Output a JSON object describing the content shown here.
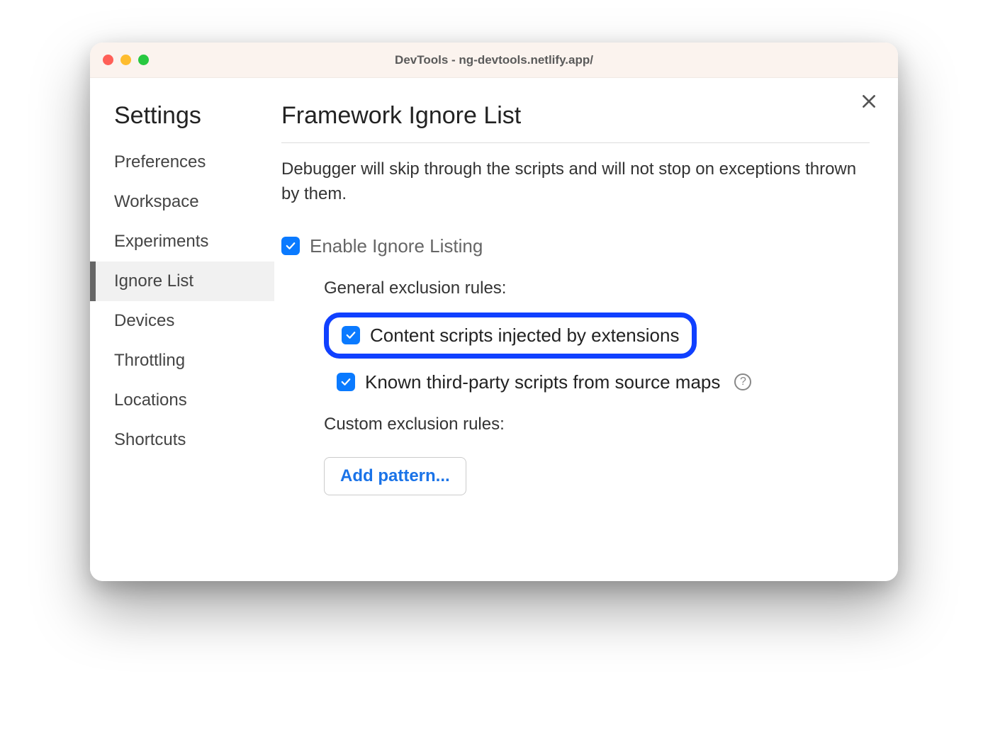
{
  "window": {
    "title": "DevTools - ng-devtools.netlify.app/"
  },
  "sidebar": {
    "title": "Settings",
    "items": [
      {
        "label": "Preferences",
        "active": false
      },
      {
        "label": "Workspace",
        "active": false
      },
      {
        "label": "Experiments",
        "active": false
      },
      {
        "label": "Ignore List",
        "active": true
      },
      {
        "label": "Devices",
        "active": false
      },
      {
        "label": "Throttling",
        "active": false
      },
      {
        "label": "Locations",
        "active": false
      },
      {
        "label": "Shortcuts",
        "active": false
      }
    ]
  },
  "main": {
    "title": "Framework Ignore List",
    "description": "Debugger will skip through the scripts and will not stop on exceptions thrown by them.",
    "enable_label": "Enable Ignore Listing",
    "enable_checked": true,
    "general_rules_label": "General exclusion rules:",
    "rule_content_scripts": {
      "label": "Content scripts injected by extensions",
      "checked": true,
      "highlighted": true
    },
    "rule_third_party": {
      "label": "Known third-party scripts from source maps",
      "checked": true,
      "has_help": true
    },
    "custom_rules_label": "Custom exclusion rules:",
    "add_pattern_label": "Add pattern..."
  },
  "colors": {
    "checkbox_bg": "#0a7aff",
    "highlight_border": "#1040ff",
    "link": "#1a73e8"
  }
}
